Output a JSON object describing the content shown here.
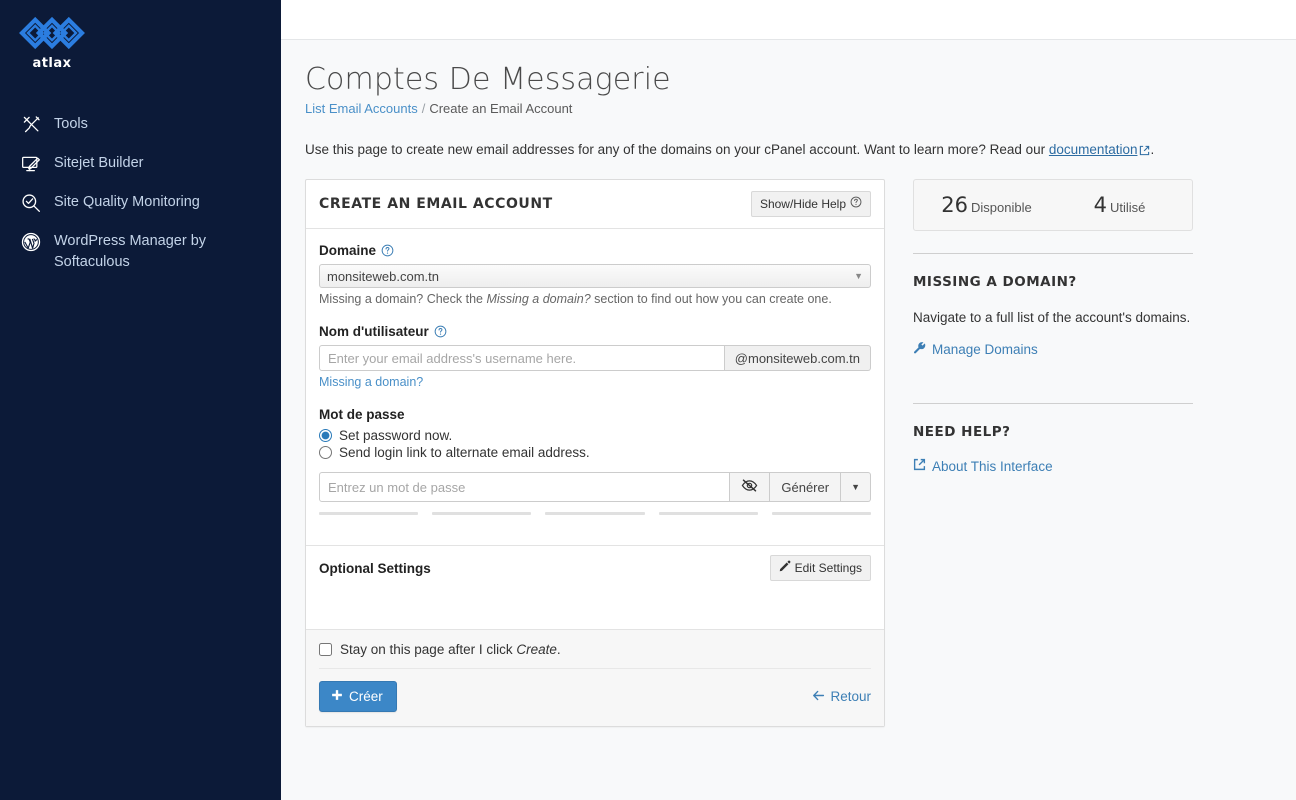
{
  "sidebar": {
    "brand": {
      "name": "atlax",
      "logo_icon": "atlax-chain-logo",
      "logo_color": "#2b7de0"
    },
    "items": [
      {
        "label": "Tools",
        "icon": "tools-icon"
      },
      {
        "label": "Sitejet Builder",
        "icon": "monitor-pen-icon"
      },
      {
        "label": "Site Quality Monitoring",
        "icon": "magnifier-check-icon"
      },
      {
        "label": "WordPress Manager by Softaculous",
        "icon": "wordpress-icon"
      }
    ]
  },
  "header": {
    "title": "Comptes De Messagerie",
    "breadcrumb": {
      "parent": "List Email Accounts",
      "separator": "/",
      "current": "Create an Email Account"
    },
    "intro_before": "Use this page to create new email addresses for any of the domains on your cPanel account. Want to learn more? Read our ",
    "intro_link": "documentation",
    "intro_after": ".",
    "external_icon": "external-link-icon"
  },
  "form": {
    "panel_title": "CREATE AN EMAIL ACCOUNT",
    "show_hide_help": "Show/Hide Help",
    "show_hide_help_icon": "question-circle-icon",
    "domain": {
      "label": "Domaine",
      "help_icon": "question-circle-icon",
      "selected": "monsiteweb.com.tn",
      "options": [
        "monsiteweb.com.tn"
      ],
      "caret_icon": "chevron-down-icon",
      "hint_before": "Missing a domain? Check the ",
      "hint_italic": "Missing a domain?",
      "hint_after": " section to find out how you can create one."
    },
    "username": {
      "label": "Nom d'utilisateur",
      "help_icon": "question-circle-icon",
      "value": "",
      "placeholder": "Enter your email address's username here.",
      "addon": "@monsiteweb.com.tn",
      "missing_domain_link": "Missing a domain?"
    },
    "password": {
      "label": "Mot de passe",
      "option_set_now": "Set password now.",
      "option_send_link": "Send login link to alternate email address.",
      "selected_option": "set_now",
      "value": "",
      "placeholder": "Entrez un mot de passe",
      "toggle_icon": "eye-slash-icon",
      "generate_label": "Générer",
      "generate_caret_icon": "caret-down-icon",
      "strength_segments": 5,
      "strength_filled": 0
    },
    "optional_settings": {
      "title": "Optional Settings",
      "edit_label": "Edit Settings",
      "edit_icon": "pencil-icon"
    },
    "footer": {
      "stay_checkbox_before": "Stay on this page after I click ",
      "stay_checkbox_italic": "Create",
      "stay_checkbox_after": ".",
      "stay_checked": false,
      "create_label": "Créer",
      "create_icon": "plus-icon",
      "back_label": "Retour",
      "back_icon": "arrow-left-icon"
    }
  },
  "side": {
    "stats": [
      {
        "number": "26",
        "label": "Disponible"
      },
      {
        "number": "4",
        "label": "Utilisé"
      }
    ],
    "missing_domain": {
      "title": "MISSING A DOMAIN?",
      "text": "Navigate to a full list of the account's domains.",
      "link": "Manage Domains",
      "link_icon": "wrench-icon"
    },
    "need_help": {
      "title": "NEED HELP?",
      "link": "About This Interface",
      "link_icon": "external-link-icon"
    }
  },
  "colors": {
    "sidebar_bg": "#0c1a38",
    "brand_blue": "#2b7de0",
    "primary_button": "#3c87c7",
    "link_blue": "#4a90c8",
    "page_bg": "#f8f9fa"
  }
}
